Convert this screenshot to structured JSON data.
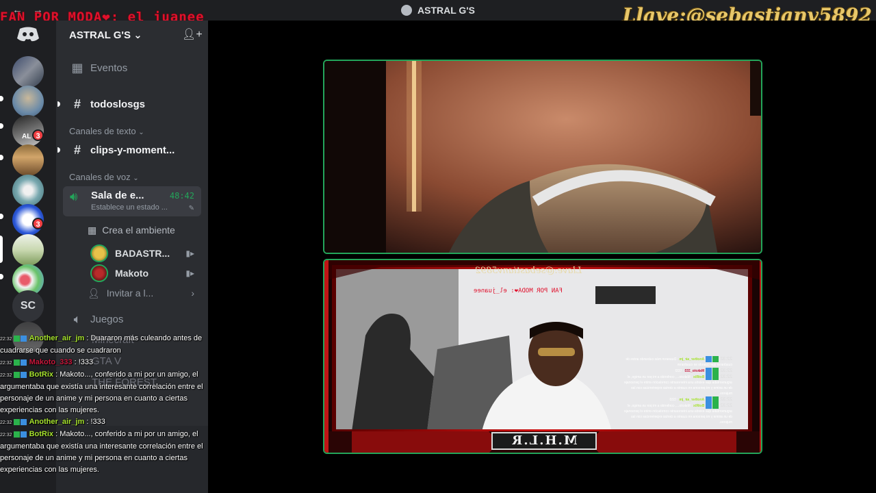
{
  "titlebar": {
    "back": "←",
    "forward": "→",
    "title": "ASTRAL G'S",
    "overlay_banner": "FAN POR MODA❤: el_juanee",
    "overlay_key": "Llave:@sebastianv5892"
  },
  "rail": {
    "home_icon": "discord-icon",
    "badges": [
      "3",
      "3"
    ],
    "sc_label": "SC",
    "al_label": "AL"
  },
  "sidebar": {
    "server_name": "ASTRAL G'S",
    "events": "Eventos",
    "general": "todoslosgs",
    "text_category": "Canales de texto",
    "clips": "clips-y-moment...",
    "voice_category": "Canales de voz",
    "voice_channel": {
      "name": "Sala de e...",
      "timer": "48:42",
      "status": "Establece un estado ..."
    },
    "create_ambient": "Crea el ambiente",
    "voice_users": [
      "BADASTR...",
      "Makoto"
    ],
    "invite": "Invitar a l...",
    "games": "Juegos",
    "faded": [
      "Minecraft",
      "GTA V",
      "THE FOREST"
    ]
  },
  "chat": [
    {
      "time": "22:32",
      "user": "Another_air_jm",
      "color": "#a6e22e",
      "text": ": Duararon más culeando antes de cuadrarse que cuando se cuadraron"
    },
    {
      "time": "22:32",
      "user": "Makoto_333",
      "color": "#c7173b",
      "text": ": !333"
    },
    {
      "time": "22:32",
      "user": "BotRix",
      "color": "#a6e22e",
      "text": ": Makoto..., conferido a mi por un amigo, el argumentaba que existía una interesante correlación entre el personaje de un anime y mi persona en cuanto a ciertas experiencias con las mujeres."
    },
    {
      "time": "22:32",
      "user": "Another_air_jm",
      "color": "#a6e22e",
      "text": ": !333"
    },
    {
      "time": "22:32",
      "user": "BotRix",
      "color": "#a6e22e",
      "text": ": Makoto..., conferido a mi por un amigo, el argumentaba que existía una interesante correlación entre el personaje de un anime y mi persona en cuanto a ciertas experiencias con las mujeres."
    }
  ],
  "stream": {
    "frame_top": "Llave:@sebastianv5892",
    "frame_banner": "FAN POR MODA❤: el_juanee",
    "frame_bottom": "M.H.L.R"
  },
  "colors": {
    "online": "#23a55a",
    "badge": "#f23f43",
    "banner_red": "#e0102c"
  }
}
